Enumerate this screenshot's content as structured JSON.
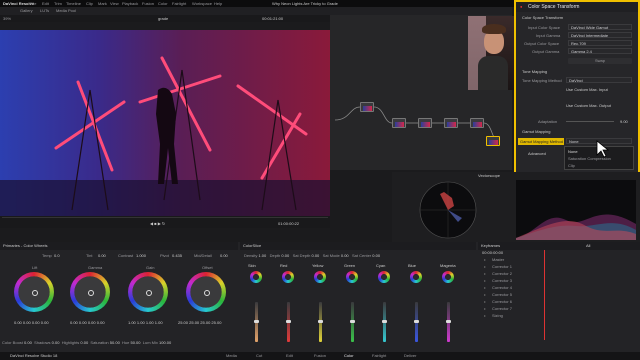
{
  "window": {
    "title": "Why Neon Lights Are Tricky to Grade",
    "app_menu": [
      "DaVinci Resolve",
      "File",
      "Edit",
      "Trim",
      "Timeline",
      "Clip",
      "Mark",
      "View",
      "Playback",
      "Fusion",
      "Color",
      "Fairlight",
      "Workspace",
      "Help"
    ],
    "clip_name": "grade",
    "zoom": "39%",
    "timecode_top": "00:01:21:00"
  },
  "toolbar": {
    "items": [
      "Gallery",
      "LUTs",
      "Media Pool"
    ]
  },
  "viewer": {
    "timecode": "01:00:00:22"
  },
  "csp": {
    "title": "Color Space Transform",
    "section1": "Color Space Transform",
    "input_color_space_label": "Input Color Space",
    "input_color_space": "DaVinci Wide Gamut",
    "input_gamma_label": "Input Gamma",
    "input_gamma": "DaVinci Intermediate",
    "output_color_space_label": "Output Color Space",
    "output_color_space": "Rec.709",
    "output_gamma_label": "Output Gamma",
    "output_gamma": "Gamma 2.4",
    "swap": "Swap",
    "section2": "Tone Mapping",
    "tone_method_label": "Tone Mapping Method",
    "tone_method": "DaVinci",
    "custom_max_input": "Use Custom Max. Input",
    "custom_max_output": "Use Custom Max. Output",
    "adaptation_label": "Adaptation",
    "adaptation": "9.00",
    "section3": "Gamut Mapping",
    "gamut_method_label": "Gamut Mapping Method",
    "gamut_method": "None",
    "dropdown": [
      "None",
      "Saturation Compression",
      "Clip"
    ],
    "advanced": "Advanced",
    "white_point": "Use White Point Adaptation"
  },
  "scopes": {
    "tab": "Vectorscope"
  },
  "wheels": {
    "title": "Primaries - Color Wheels",
    "params": [
      {
        "label": "Temp",
        "value": "0.0"
      },
      {
        "label": "Tint",
        "value": "0.00"
      },
      {
        "label": "Contrast",
        "value": "1.000"
      },
      {
        "label": "Pivot",
        "value": "0.435"
      },
      {
        "label": "Mid/Detail",
        "value": "0.00"
      }
    ],
    "items": [
      {
        "name": "Lift",
        "values": [
          "0.00",
          "0.00",
          "0.00",
          "0.00"
        ]
      },
      {
        "name": "Gamma",
        "values": [
          "0.00",
          "0.00",
          "0.00",
          "0.00"
        ]
      },
      {
        "name": "Gain",
        "values": [
          "1.00",
          "1.00",
          "1.00",
          "1.00"
        ]
      },
      {
        "name": "Offset",
        "values": [
          "25.00",
          "25.00",
          "25.00",
          "25.00"
        ]
      }
    ],
    "bottom": [
      "Color Boost",
      "0.00",
      "Shadows",
      "0.00",
      "Highlights",
      "0.00",
      "Saturation",
      "50.00",
      "Hue",
      "50.00",
      "Lum Mix",
      "100.00"
    ]
  },
  "colorslice": {
    "title": "ColorSlice",
    "params": [
      "Density",
      "Depth",
      "Sat Depth",
      "Sat Mode",
      "Sat Center"
    ],
    "values": [
      "1.00",
      "0.00",
      "0.00",
      "0.00",
      "0.00"
    ],
    "slices": [
      {
        "name": "Skin",
        "color": "#e3a36a"
      },
      {
        "name": "Red",
        "color": "#e23a3a"
      },
      {
        "name": "Yellow",
        "color": "#e0d33a"
      },
      {
        "name": "Green",
        "color": "#3ac24a"
      },
      {
        "name": "Cyan",
        "color": "#35c8d0"
      },
      {
        "name": "Blue",
        "color": "#3a56e0"
      },
      {
        "name": "Magenta",
        "color": "#d03ad0"
      }
    ],
    "row_labels": [
      "Center",
      "Density",
      "Hue",
      "Sat"
    ]
  },
  "keyframes": {
    "title": "Keyframes",
    "filter": "All",
    "timecode": "00:00:00:00",
    "rows": [
      "Master",
      "Corrector 1",
      "Corrector 2",
      "Corrector 3",
      "Corrector 4",
      "Corrector 5",
      "Corrector 6",
      "Corrector 7",
      "Sizing"
    ]
  },
  "pages": {
    "items": [
      "Media",
      "Cut",
      "Edit",
      "Fusion",
      "Color",
      "Fairlight",
      "Deliver"
    ],
    "active": "Color",
    "product": "DaVinci Resolve Studio 18"
  }
}
